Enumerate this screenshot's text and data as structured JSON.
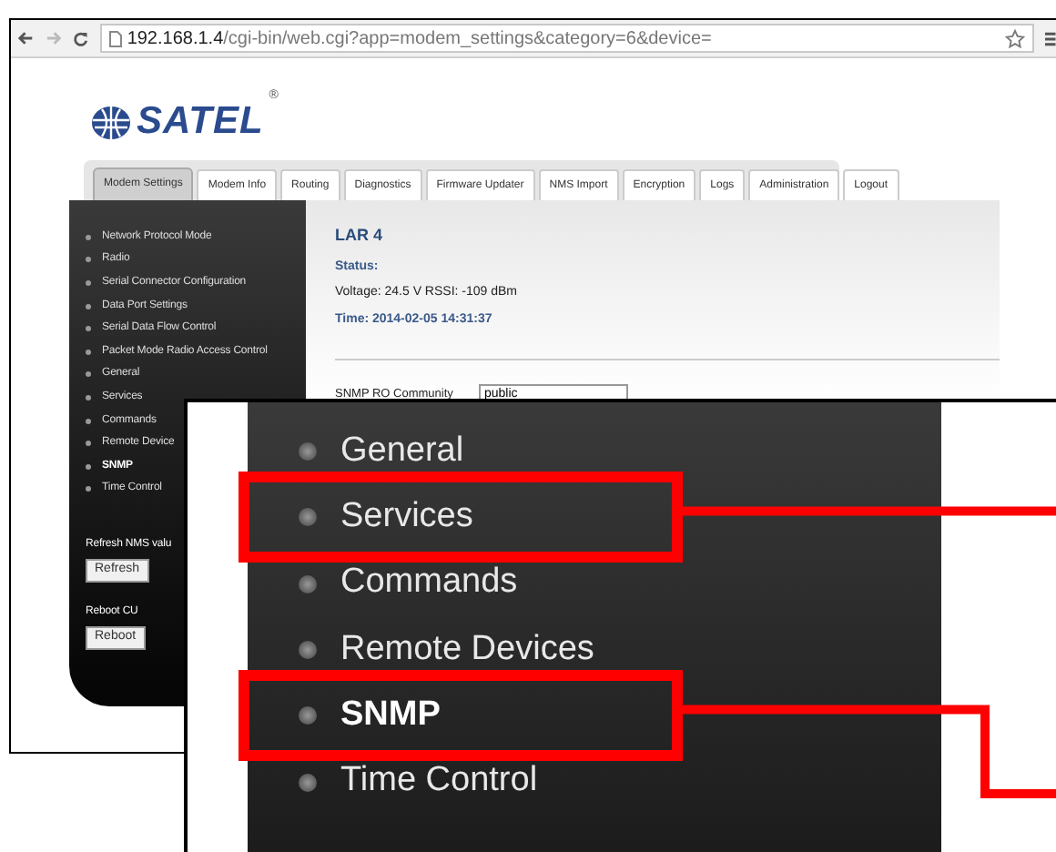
{
  "browser": {
    "url_host": "192.168.1.4",
    "url_rest": "/cgi-bin/web.cgi?app=modem_settings&category=6&device="
  },
  "logo": {
    "text": "SATEL",
    "mark": "®"
  },
  "tabs": [
    {
      "label": "Modem Settings",
      "selected": true
    },
    {
      "label": "Modem Info",
      "selected": false
    },
    {
      "label": "Routing",
      "selected": false
    },
    {
      "label": "Diagnostics",
      "selected": false
    },
    {
      "label": "Firmware Updater",
      "selected": false
    },
    {
      "label": "NMS Import",
      "selected": false
    },
    {
      "label": "Encryption",
      "selected": false
    },
    {
      "label": "Logs",
      "selected": false
    },
    {
      "label": "Administration",
      "selected": false
    },
    {
      "label": "Logout",
      "selected": false
    }
  ],
  "sidebar": {
    "items": [
      {
        "label": "Network Protocol Mode",
        "selected": false
      },
      {
        "label": "Radio",
        "selected": false
      },
      {
        "label": "Serial Connector Configuration",
        "selected": false
      },
      {
        "label": "Data Port Settings",
        "selected": false
      },
      {
        "label": "Serial Data Flow Control",
        "selected": false
      },
      {
        "label": "Packet Mode Radio Access Control",
        "selected": false
      },
      {
        "label": "General",
        "selected": false
      },
      {
        "label": "Services",
        "selected": false
      },
      {
        "label": "Commands",
        "selected": false
      },
      {
        "label": "Remote Device",
        "selected": false
      },
      {
        "label": "SNMP",
        "selected": true
      },
      {
        "label": "Time Control",
        "selected": false
      }
    ],
    "actions": [
      {
        "label": "Refresh NMS valu",
        "button": "Refresh"
      },
      {
        "label": "Reboot CU",
        "button": "Reboot"
      }
    ]
  },
  "content": {
    "device": "LAR 4",
    "status_label": "Status:",
    "status_text": "Voltage: 24.5 V RSSI: -109 dBm",
    "time": "Time: 2014-02-05 14:31:37",
    "fields": [
      {
        "label": "SNMP RO Community",
        "value": "public"
      }
    ]
  },
  "callout": {
    "items": [
      {
        "label": "General",
        "selected": false,
        "highlighted": false
      },
      {
        "label": "Services",
        "selected": false,
        "highlighted": true
      },
      {
        "label": "Commands",
        "selected": false,
        "highlighted": false
      },
      {
        "label": "Remote Devices",
        "selected": false,
        "highlighted": false
      },
      {
        "label": "SNMP",
        "selected": true,
        "highlighted": true
      },
      {
        "label": "Time Control",
        "selected": false,
        "highlighted": false
      }
    ]
  }
}
